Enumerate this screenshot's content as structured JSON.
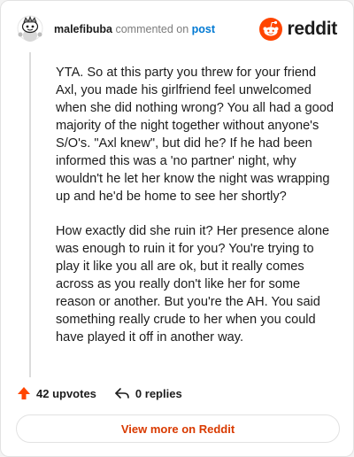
{
  "header": {
    "username": "malefibuba",
    "action_text": "commented on",
    "post_link": "post",
    "brand": "reddit"
  },
  "comment": {
    "paragraphs": [
      "YTA. So at this party you threw for your friend Axl, you made his girlfriend feel unwelcomed when she did nothing wrong? You all had a good majority of the night together without anyone's S/O's. \"Axl knew\", but did he? If he had been informed this was a 'no partner' night, why wouldn't he let her know the night was wrapping up and he'd be home to see her shortly?",
      "How exactly did she ruin it? Her presence alone was enough to ruin it for you? You're trying to play it like you all are ok, but it really comes across as you really don't like her for some reason or another. But you're the AH. You said something really crude to her when you could have played it off in another way."
    ]
  },
  "actions": {
    "upvotes": "42 upvotes",
    "replies": "0 replies"
  },
  "view_more_label": "View more on Reddit",
  "colors": {
    "brand_orange": "#ff4500",
    "link_blue": "#0079d3",
    "cta_text": "#d93a00"
  }
}
